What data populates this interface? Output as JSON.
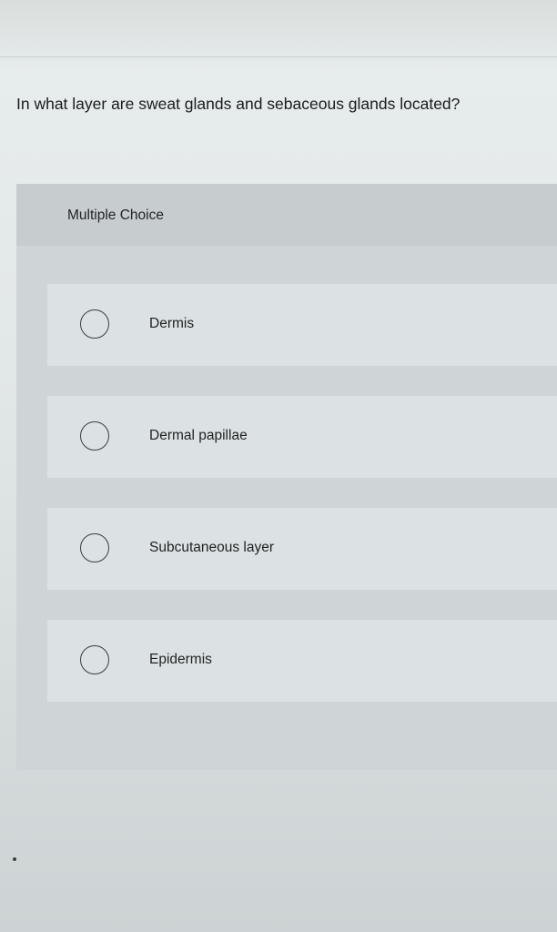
{
  "question": {
    "text": "In what layer are sweat glands and sebaceous glands located?"
  },
  "card": {
    "header_label": "Multiple Choice"
  },
  "options": [
    {
      "label": "Dermis",
      "selected": false
    },
    {
      "label": "Dermal papillae",
      "selected": false
    },
    {
      "label": "Subcutaneous layer",
      "selected": false
    },
    {
      "label": "Epidermis",
      "selected": false
    }
  ],
  "colors": {
    "background": "#e2e7e7",
    "card": "#cfd5d6",
    "option": "#dce2e3",
    "text": "#1d1f21"
  }
}
